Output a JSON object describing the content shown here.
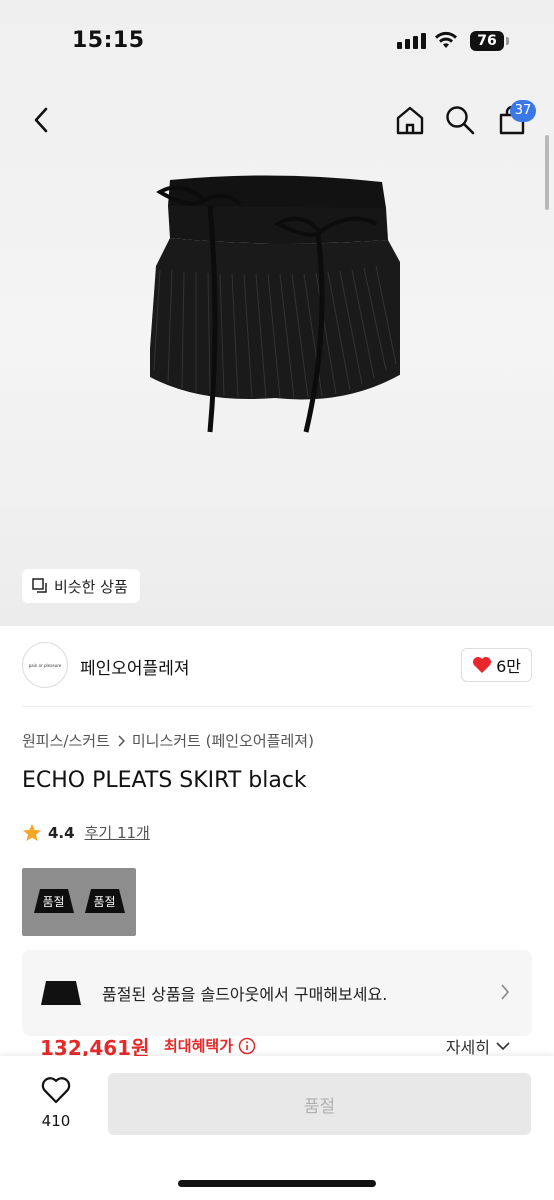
{
  "status_bar": {
    "time": "15:15",
    "battery": "76"
  },
  "header": {
    "cart_count": "37",
    "icons": [
      "back-icon",
      "home-icon",
      "search-icon",
      "cart-icon"
    ]
  },
  "hero": {
    "similar_label": "비슷한 상품"
  },
  "brand": {
    "name": "페인오어플레져",
    "logo_text": "pain or pleasure",
    "likes": "6만"
  },
  "breadcrumb": {
    "category": "원피스/스커트",
    "subcategory": "미니스커트 (페인오어플레져)"
  },
  "product": {
    "title": "ECHO PLEATS SKIRT black",
    "rating": "4.4",
    "reviews": "후기 11개",
    "thumbnails": [
      {
        "badge": "품절"
      },
      {
        "badge": "품절"
      }
    ]
  },
  "soldout_card": {
    "message": "품절된 상품을 솔드아웃에서 구매해보세요."
  },
  "price": {
    "amount": "132,461원",
    "benefit_label": "최대혜택가",
    "detail_label": "자세히"
  },
  "bottom_bar": {
    "wish_count": "410",
    "buy_label": "품절"
  },
  "colors": {
    "accent": "#e62a2a",
    "badge": "#3a78e7",
    "heart": "#e8262b",
    "star": "#f5a623"
  }
}
